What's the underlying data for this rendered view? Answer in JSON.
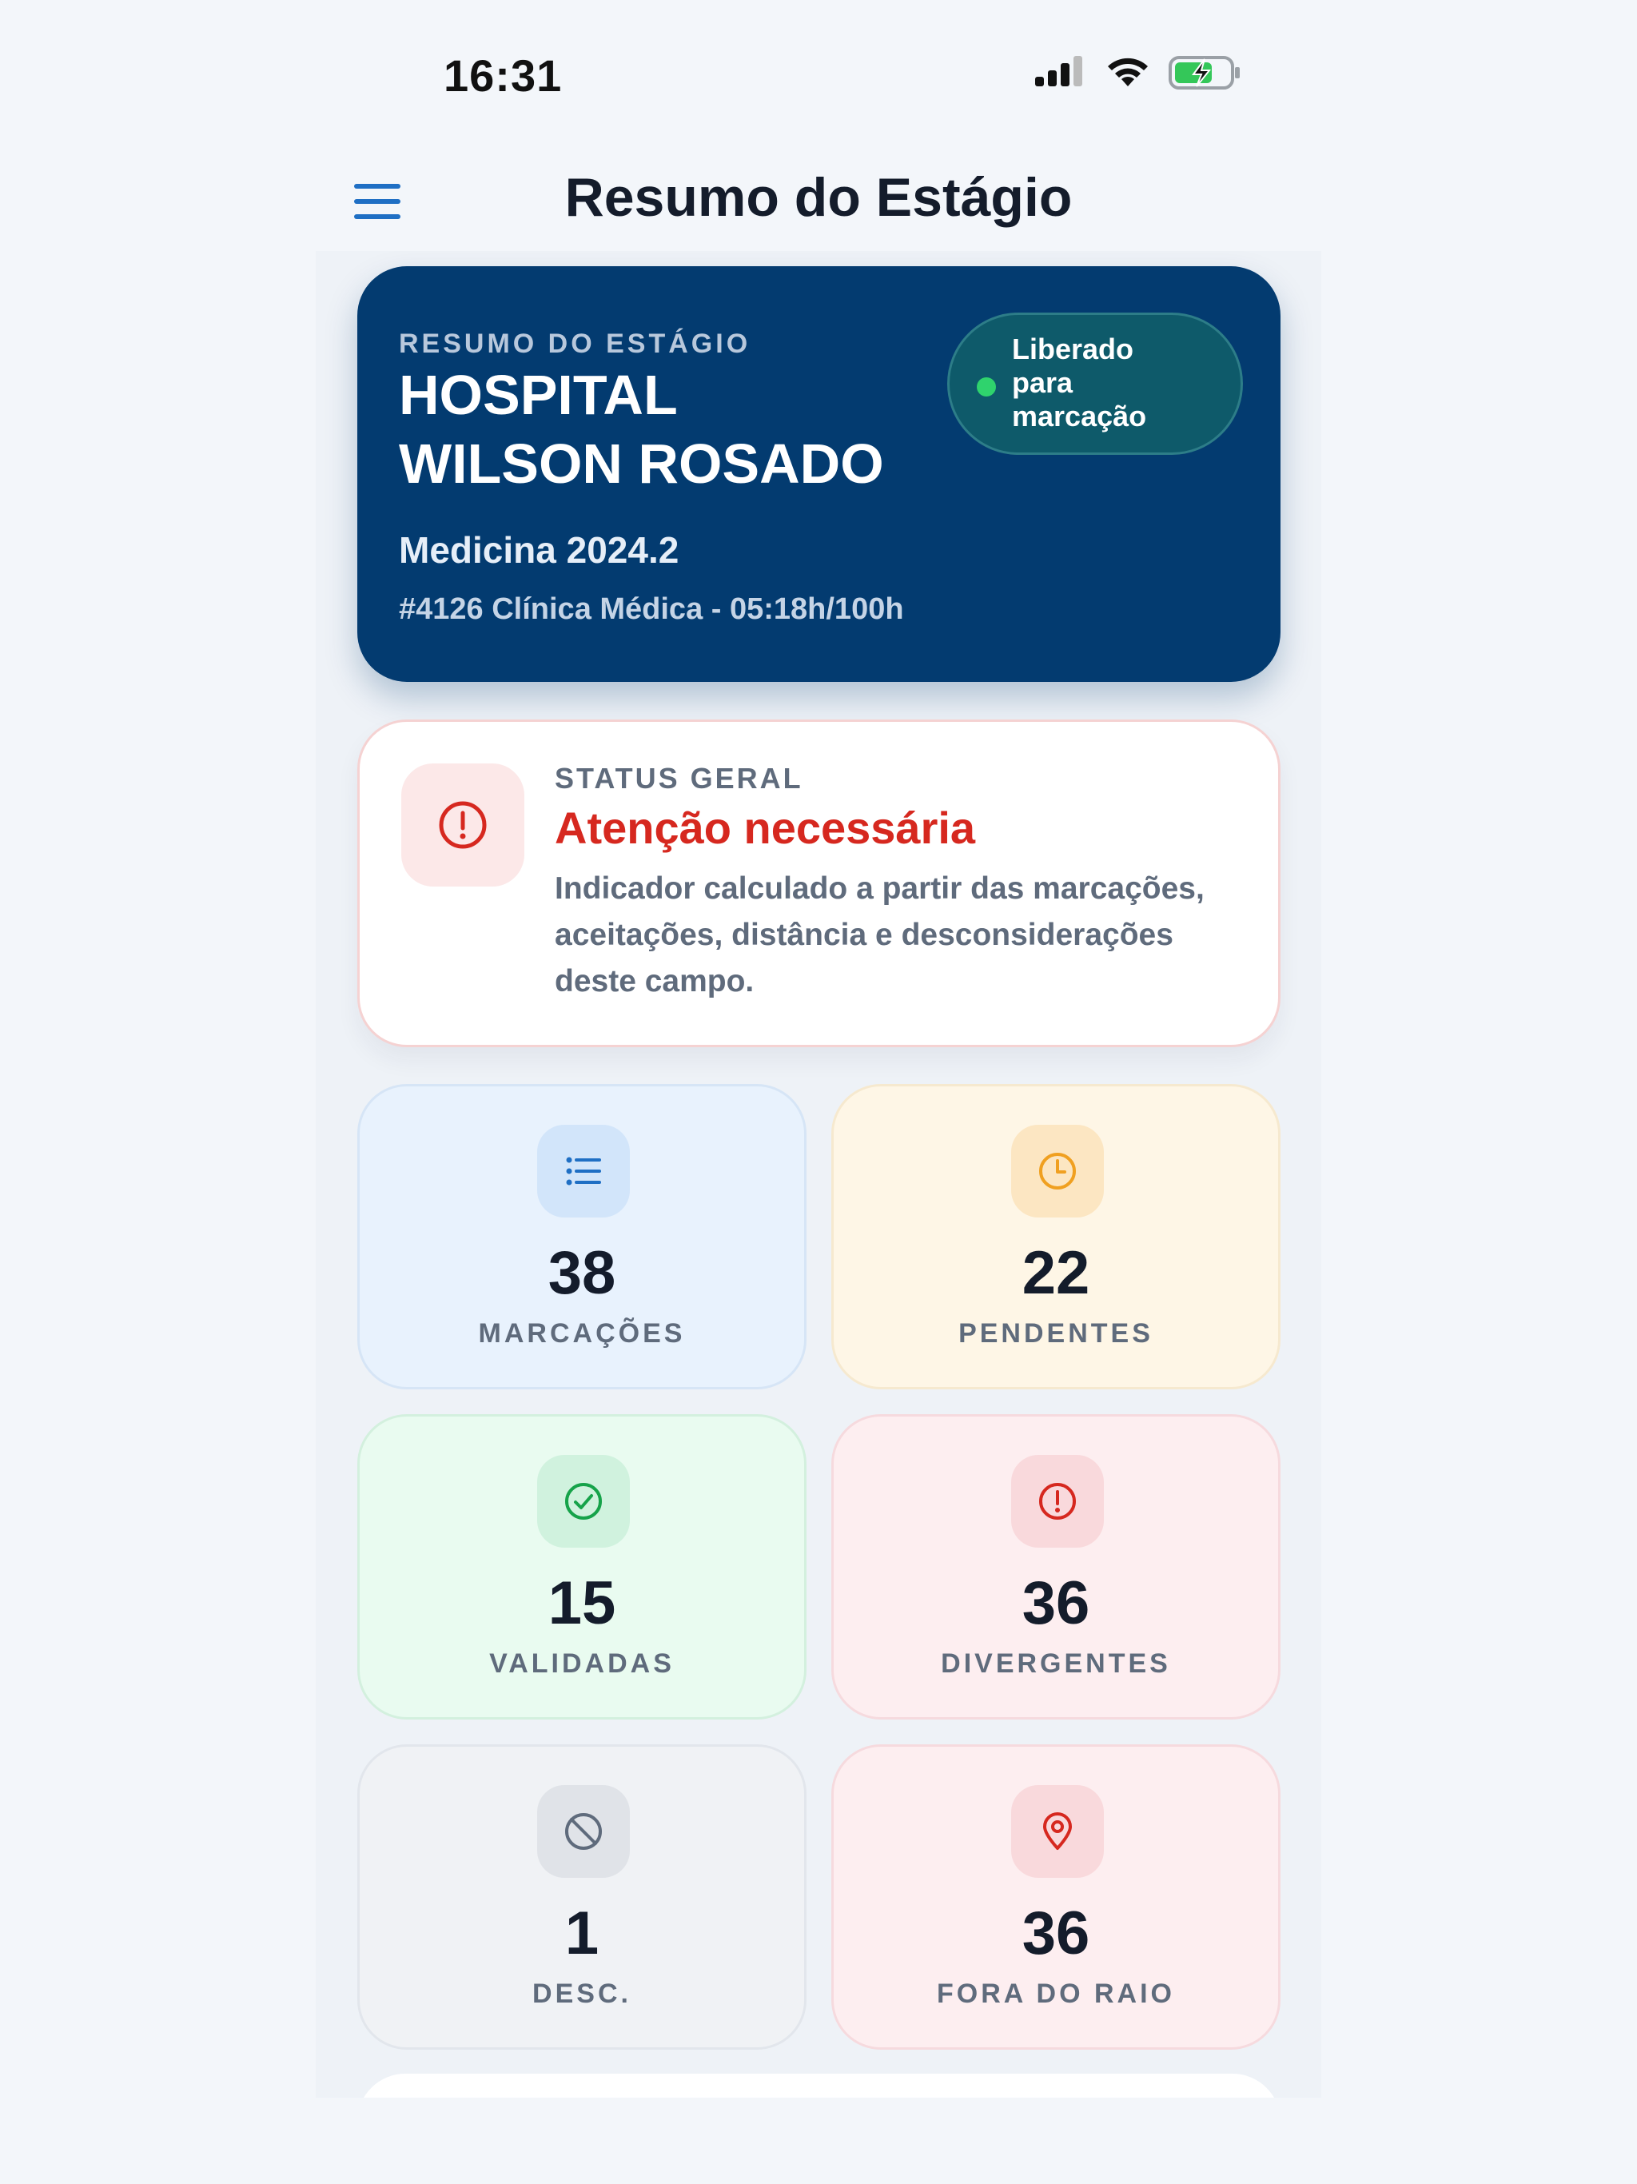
{
  "status_bar": {
    "time": "16:31"
  },
  "header": {
    "title": "Resumo do Estágio"
  },
  "hero": {
    "eyebrow": "RESUMO DO ESTÁGIO",
    "title_line1": "HOSPITAL",
    "title_line2": "WILSON ROSADO",
    "course": "Medicina 2024.2",
    "detail": "#4126 Clínica Médica - 05:18h/100h",
    "badge_line1": "Liberado",
    "badge_line2": "para",
    "badge_line3": "marcação",
    "badge_dot_color": "#2fd36d"
  },
  "status": {
    "label": "STATUS GERAL",
    "title": "Atenção necessária",
    "description": "Indicador calculado a partir das marcações, aceitações, distância e desconsiderações deste campo.",
    "icon": "alert-circle-icon",
    "color": "#d6281f"
  },
  "stats": [
    {
      "value": "38",
      "label": "MARCAÇÕES",
      "icon": "list-icon",
      "color": "#1f6fc4"
    },
    {
      "value": "22",
      "label": "PENDENTES",
      "icon": "clock-icon",
      "color": "#f0a020"
    },
    {
      "value": "15",
      "label": "VALIDADAS",
      "icon": "check-circle-icon",
      "color": "#16a34a"
    },
    {
      "value": "36",
      "label": "DIVERGENTES",
      "icon": "alert-circle-icon",
      "color": "#d6281f"
    },
    {
      "value": "1",
      "label": "DESC.",
      "icon": "ban-icon",
      "color": "#5f6b7c"
    },
    {
      "value": "36",
      "label": "FORA DO RAIO",
      "icon": "map-pin-icon",
      "color": "#d6281f"
    }
  ]
}
